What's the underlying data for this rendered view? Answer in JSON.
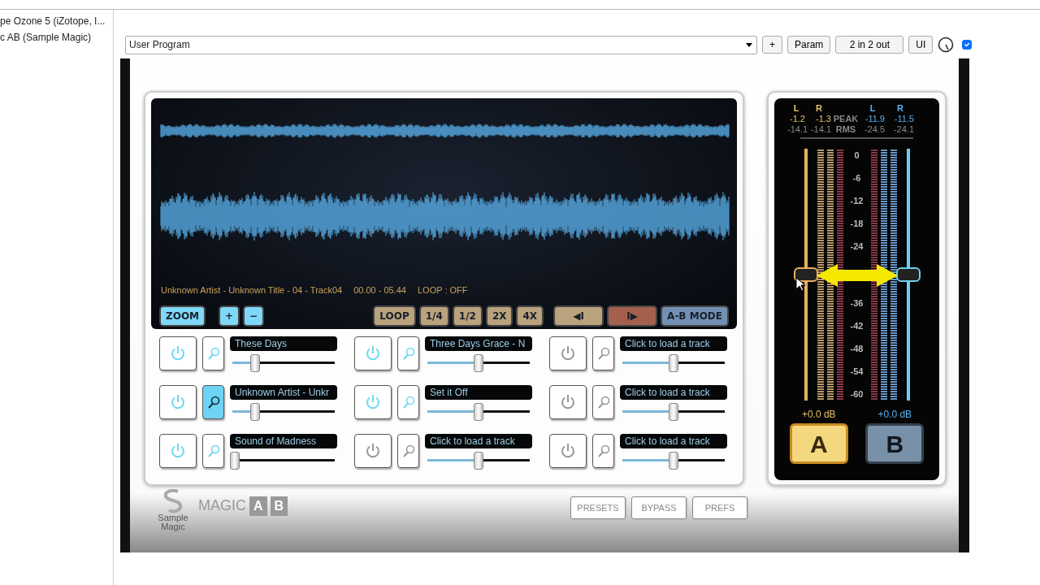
{
  "sidebar": {
    "items": [
      {
        "label": "pe Ozone 5 (iZotope, I..."
      },
      {
        "label": "c AB (Sample Magic)"
      }
    ]
  },
  "toolbar": {
    "program": "User Program",
    "buttons": [
      "+",
      "Param",
      "2 in 2 out",
      "UI"
    ],
    "checked": true
  },
  "display": {
    "info": "Unknown Artist - Unknown Title - 04 - Track04",
    "time": "00.00 - 05.44",
    "loop": "LOOP : OFF",
    "zoom_controls": [
      {
        "label": "ZOOM",
        "color": "#7fd8f8"
      },
      {
        "label": "+",
        "color": "#7fd8f8"
      },
      {
        "label": "−",
        "color": "#7fd8f8"
      }
    ],
    "transport_controls": [
      {
        "label": "LOOP",
        "color": "#b9a27c"
      },
      {
        "label": "1/4",
        "color": "#b9a27c"
      },
      {
        "label": "1/2",
        "color": "#b9a27c"
      },
      {
        "label": "2X",
        "color": "#b9a27c"
      },
      {
        "label": "4X",
        "color": "#b9a27c"
      },
      {
        "label": "◀I",
        "color": "#b9a27c"
      },
      {
        "label": "I▶",
        "color": "#a4604c"
      },
      {
        "label": "A-B MODE",
        "color": "#7290b4"
      }
    ]
  },
  "tracks": [
    {
      "title": "These Days",
      "on": true,
      "selected": false,
      "level": 0.22
    },
    {
      "title": "Three Days Grace - N",
      "on": true,
      "selected": false,
      "level": 0.5
    },
    {
      "title": "Click to load a track",
      "on": false,
      "selected": false,
      "level": 0.5
    },
    {
      "title": "Unknown Artist - Unkr",
      "on": true,
      "selected": true,
      "level": 0.22
    },
    {
      "title": "Set it Off",
      "on": true,
      "selected": false,
      "level": 0.5
    },
    {
      "title": "Click to load a track",
      "on": false,
      "selected": false,
      "level": 0.5
    },
    {
      "title": "Sound of Madness",
      "on": true,
      "selected": false,
      "level": 0.02
    },
    {
      "title": "Click to load a track",
      "on": false,
      "selected": false,
      "level": 0.5
    },
    {
      "title": "Click to load a track",
      "on": false,
      "selected": false,
      "level": 0.5
    }
  ],
  "meters": {
    "channel_labels": [
      "L",
      "R",
      "L",
      "R"
    ],
    "peak_label": "PEAK",
    "rms_label": "RMS",
    "peak": [
      "-1.2",
      "-1.3",
      "-11.9",
      "-11.5"
    ],
    "rms": [
      "-14.1",
      "-14.1",
      "-24.5",
      "-24.1"
    ],
    "scale_upper": [
      "0",
      "-6",
      "-12",
      "-18",
      "-24"
    ],
    "scale_lower": [
      "-36",
      "-42",
      "-48",
      "-54",
      "-60"
    ],
    "faders": [
      {
        "gain": "+0.0 dB",
        "level": 0.5
      },
      {
        "gain": "+0.0 dB",
        "level": 0.5
      }
    ],
    "ab": [
      {
        "label": "A",
        "selected": true
      },
      {
        "label": "B",
        "selected": false
      }
    ]
  },
  "footer": {
    "logo_text": "Sample Magic",
    "brand": [
      "MAGIC",
      "A",
      "B"
    ],
    "buttons": [
      "PRESETS",
      "BYPASS",
      "PREFS"
    ]
  }
}
